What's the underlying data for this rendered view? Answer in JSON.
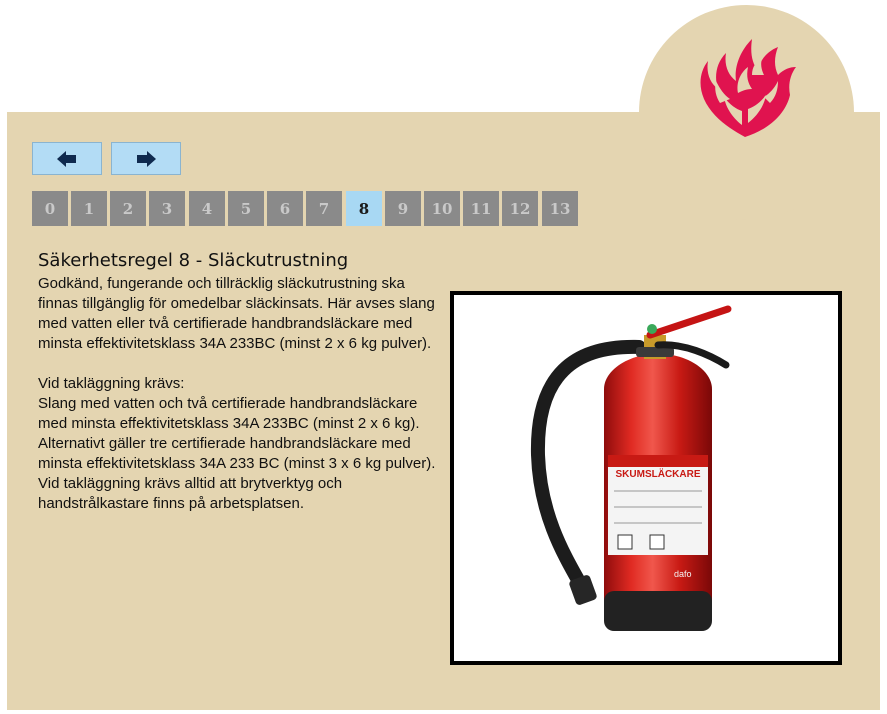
{
  "navigation": {
    "prev_icon": "arrow-left-icon",
    "next_icon": "arrow-right-icon",
    "pages": [
      "0",
      "1",
      "2",
      "3",
      "4",
      "5",
      "6",
      "7",
      "8",
      "9",
      "10",
      "11",
      "12",
      "13"
    ],
    "active_page": "8"
  },
  "content": {
    "title": "Säkerhetsregel 8 - Släckutrustning",
    "paragraphs": [
      "Godkänd, fungerande och tillräcklig släckutrustning ska finnas tillgänglig för omedelbar släckinsats. Här avses slang med vatten eller två certifierade handbrandsläckare med minsta effektivitetsklass 34A 233BC (minst 2 x 6 kg pulver).",
      "Vid takläggning krävs:",
      "Slang med vatten och två certifierade handbrandsläckare med minsta effektivitetsklass 34A 233BC (minst 2 x 6 kg).",
      "Alternativt gäller tre certifierade handbrandsläckare med minsta effektivitetsklass 34A 233 BC (minst 3 x 6 kg pulver). Vid takläggning krävs alltid att brytverktyg och handstrålkastare finns på arbetsplatsen."
    ]
  },
  "photo": {
    "label": "SKUMSLÄCKARE",
    "brand": "dafo"
  },
  "colors": {
    "panel": "#e4d5b1",
    "logo": "#e0134f",
    "tab_inactive": "#8a8a8a",
    "tab_active": "#a8d8f3",
    "nav_button": "#b3dcf5"
  }
}
